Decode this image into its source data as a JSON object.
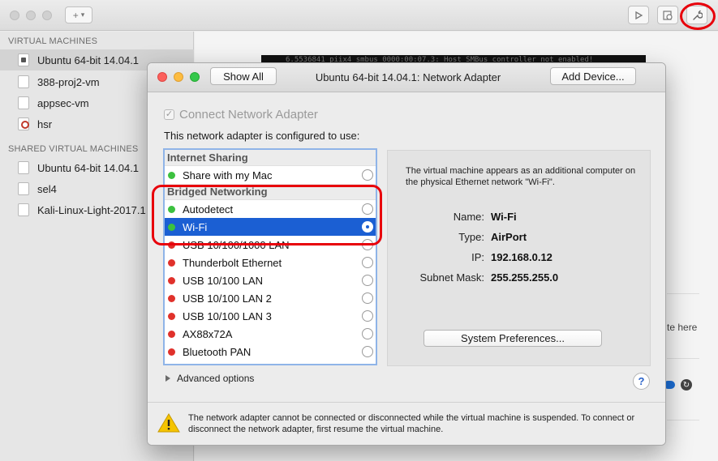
{
  "sidebar": {
    "virtual_machines_header": "VIRTUAL MACHINES",
    "virtual_machines": [
      {
        "label": "Ubuntu 64-bit 14.04.1",
        "selected": true,
        "icon": "vm-running-icon"
      },
      {
        "label": "388-proj2-vm",
        "selected": false,
        "icon": "vm-icon"
      },
      {
        "label": "appsec-vm",
        "selected": false,
        "icon": "vm-icon"
      },
      {
        "label": "hsr",
        "selected": false,
        "icon": "vm-hsr-icon"
      }
    ],
    "shared_header": "SHARED VIRTUAL MACHINES",
    "shared_machines": [
      {
        "label": "Ubuntu 64-bit 14.04.1",
        "icon": "vm-icon"
      },
      {
        "label": "sel4",
        "icon": "vm-icon"
      },
      {
        "label": "Kali-Linux-Light-2017.1",
        "icon": "vm-icon"
      }
    ]
  },
  "toolbar": {
    "add_label": "+",
    "add_chevron": "▾"
  },
  "console": {
    "line": "6.5536841 piix4_smbus 0000:00:07.3: Host SMBus controller not enabled!"
  },
  "background_peek": {
    "here_text": "te here"
  },
  "dialog": {
    "title": "Ubuntu 64-bit 14.04.1: Network Adapter",
    "show_all_label": "Show All",
    "add_device_label": "Add Device...",
    "connect_label": "Connect Network Adapter",
    "connect_checked": true,
    "config_text": "This network adapter is configured to use:",
    "groups": [
      {
        "label": "Internet Sharing",
        "items": [
          {
            "label": "Share with my Mac",
            "status_color": "#3cc13f",
            "selected": false
          }
        ]
      },
      {
        "label": "Bridged Networking",
        "items": [
          {
            "label": "Autodetect",
            "status_color": "#3cc13f",
            "selected": false
          },
          {
            "label": "Wi-Fi",
            "status_color": "#3cc13f",
            "selected": true
          },
          {
            "label": "USB 10/100/1000 LAN",
            "status_color": "#e0312b",
            "selected": false
          },
          {
            "label": "Thunderbolt Ethernet",
            "status_color": "#e0312b",
            "selected": false
          },
          {
            "label": "USB 10/100 LAN",
            "status_color": "#e0312b",
            "selected": false
          },
          {
            "label": "USB 10/100 LAN 2",
            "status_color": "#e0312b",
            "selected": false
          },
          {
            "label": "USB 10/100 LAN 3",
            "status_color": "#e0312b",
            "selected": false
          },
          {
            "label": "AX88x72A",
            "status_color": "#e0312b",
            "selected": false
          },
          {
            "label": "Bluetooth PAN",
            "status_color": "#e0312b",
            "selected": false
          }
        ]
      }
    ],
    "advanced_label": "Advanced options",
    "info": {
      "description": "The virtual machine appears as an additional computer on the physical Ethernet network \"Wi-Fi\".",
      "fields": [
        {
          "key": "Name:",
          "value": "Wi-Fi"
        },
        {
          "key": "Type:",
          "value": "AirPort"
        },
        {
          "key": "IP:",
          "value": "192.168.0.12"
        },
        {
          "key": "Subnet Mask:",
          "value": "255.255.255.0"
        }
      ],
      "system_prefs_label": "System Preferences..."
    },
    "help_label": "?",
    "warning": "The network adapter cannot be connected or disconnected while the virtual machine is suspended. To connect or disconnect the network adapter, first resume the virtual machine."
  },
  "colors": {
    "selection": "#1b5fd3",
    "annotation_red": "#e8000b",
    "status_green": "#3cc13f",
    "status_red": "#e0312b"
  }
}
